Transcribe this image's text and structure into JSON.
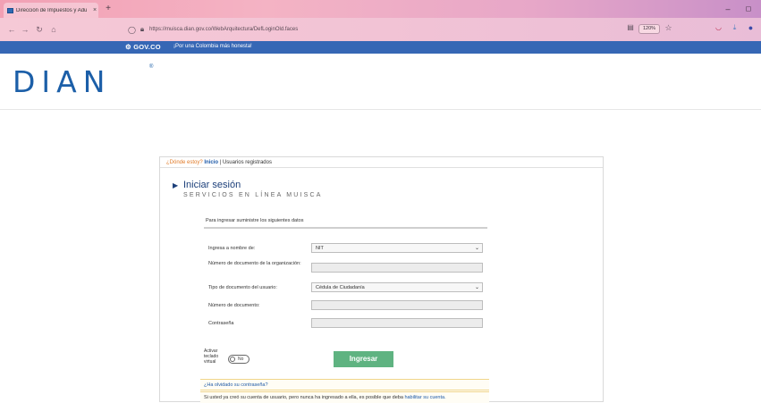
{
  "browser": {
    "tab_title": "Dirección de Impuestos y Adu",
    "tab_close": "×",
    "new_tab": "+",
    "url": "https://muisca.dian.gov.co/WebArquitectura/DefLoginOld.faces",
    "zoom": "120%",
    "icons": [
      "back-icon",
      "forward-icon",
      "reload-icon",
      "home-icon",
      "shield-icon",
      "lock-icon",
      "reader-icon",
      "star-icon",
      "pocket-icon",
      "download-icon",
      "account-icon"
    ]
  },
  "govbar": {
    "logo": "GOV.CO",
    "slogan": "¡Por una Colombia más honesta!",
    "color": "#3667b5"
  },
  "brand": {
    "logo_text": "DIAN",
    "registered": "®",
    "color": "#1c5fa8"
  },
  "breadcrumb": {
    "where": "¿Dónde estoy?",
    "home": "Inicio",
    "separator": "|",
    "current": "Usuarios registrados"
  },
  "login": {
    "title": "Iniciar sesión",
    "subtitle": "SERVICIOS EN LÍNEA MUISCA",
    "instructions": "Para ingresar suministre los siguientes datos",
    "fields": {
      "ingresa_label": "Ingresa a nombre de:",
      "ingresa_value": "NIT",
      "org_doc_label": "Número de documento de la organización:",
      "user_doc_type_label": "Tipo de documento del usuario:",
      "user_doc_type_value": "Cédula de Ciudadanía",
      "doc_number_label": "Número de documento:",
      "password_label": "Contraseña"
    },
    "keyboard_label": "Activar teclado virtual",
    "keyboard_toggle": "No",
    "submit_label": "Ingresar",
    "submit_color": "#5fb381",
    "forgot": "¿Ha olvidado su contraseña?",
    "notice_text": "Si usted ya creó su cuenta de usuario, pero nunca ha ingresado a ella, es posible que deba ",
    "notice_link": "habilitar su cuenta."
  }
}
